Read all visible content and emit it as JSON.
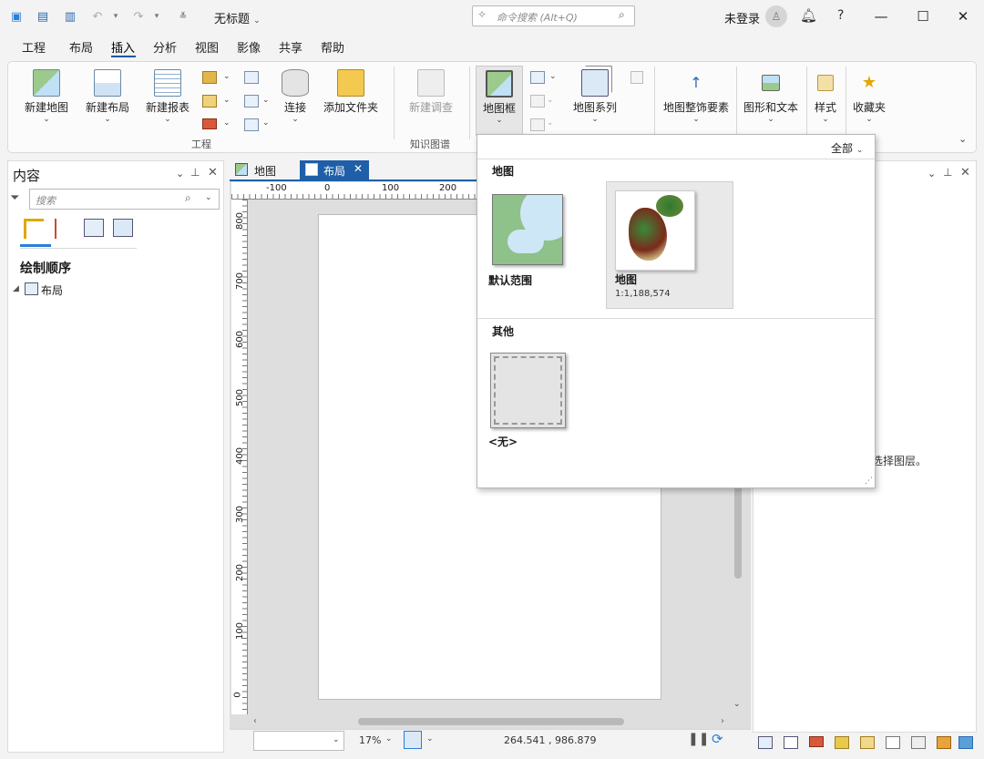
{
  "title": "无标题",
  "search_placeholder": "命令搜索 (Alt+Q)",
  "user": "未登录",
  "help": "?",
  "menus": [
    "工程",
    "布局",
    "插入",
    "分析",
    "视图",
    "影像",
    "共享",
    "帮助"
  ],
  "ribbon": {
    "new_map": "新建地图",
    "new_layout": "新建布局",
    "new_report": "新建报表",
    "connect": "连接",
    "add_folder": "添加文件夹",
    "new_survey": "新建调查",
    "map_frame": "地图框",
    "map_series": "地图系列",
    "map_surround": "地图整饰要素",
    "graphics_text": "图形和文本",
    "style": "样式",
    "favorites": "收藏夹",
    "group_project": "工程",
    "group_kg": "知识图谱"
  },
  "contents": {
    "title": "内容",
    "search_placeholder": "搜索",
    "drawing_order": "绘制顺序",
    "tree_item": "布局"
  },
  "tabs": [
    "地图",
    "布局"
  ],
  "ruler_top": [
    "-100",
    "0",
    "100",
    "200"
  ],
  "ruler_left": [
    "800",
    "700",
    "600",
    "500",
    "400",
    "300",
    "200",
    "100",
    "0"
  ],
  "dropdown": {
    "filter": "全部",
    "section_map": "地图",
    "tile_default": "默认范围",
    "tile_map": "地图",
    "tile_map_scale": "1:1,188,574",
    "section_other": "其他",
    "tile_none": "<无>"
  },
  "right_panel_text": "选择图层。",
  "status": {
    "zoom": "17%",
    "coords": "264.541 , 986.879"
  },
  "colors": {
    "accent": "#005ba1",
    "tab_active": "#1e5fa8",
    "tile_selected_bg": "#e9e9e9"
  }
}
